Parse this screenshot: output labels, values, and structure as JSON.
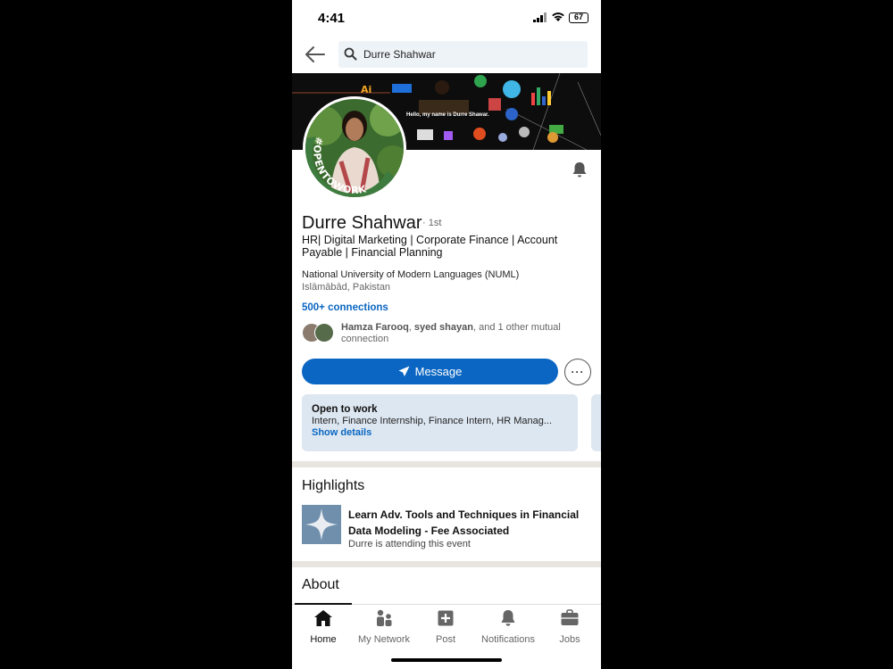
{
  "status": {
    "time": "4:41",
    "battery": "67"
  },
  "search": {
    "query": "Durre Shahwar"
  },
  "banner": {
    "text": "Hello, my name is Durre Shawar."
  },
  "badge": {
    "text": "#OPENTOWORK"
  },
  "profile": {
    "name": "Durre Shahwar",
    "degree": "· 1st",
    "headline": "HR| Digital Marketing | Corporate Finance | Account Payable | Financial Planning",
    "education": "National University of Modern Languages (NUML)",
    "location": "Islāmābād, Pakistan",
    "connections": "500+ connections",
    "mutual_name1": "Hamza Farooq",
    "mutual_sep": ", ",
    "mutual_name2": "syed shayan",
    "mutual_rest": ", and 1 other mutual connection"
  },
  "actions": {
    "message_label": "Message",
    "more_label": "···"
  },
  "open_to_work": {
    "title": "Open to work",
    "roles": "Intern, Finance Internship, Finance Intern, HR Manag...",
    "link": "Show details"
  },
  "highlights": {
    "title": "Highlights",
    "item_title": "Learn Adv. Tools and Techniques in Financial Data Modeling - Fee Associated",
    "item_sub": "Durre is attending this event"
  },
  "about": {
    "title": "About"
  },
  "nav": [
    {
      "label": "Home",
      "icon": "home-icon",
      "active": true
    },
    {
      "label": "My Network",
      "icon": "network-icon",
      "active": false
    },
    {
      "label": "Post",
      "icon": "post-icon",
      "active": false
    },
    {
      "label": "Notifications",
      "icon": "bell-icon",
      "active": false
    },
    {
      "label": "Jobs",
      "icon": "briefcase-icon",
      "active": false
    }
  ],
  "colors": {
    "brand_blue": "#0a66c2",
    "open_to_work_green": "#3e7b3f",
    "card_bg": "#dde7f1"
  }
}
